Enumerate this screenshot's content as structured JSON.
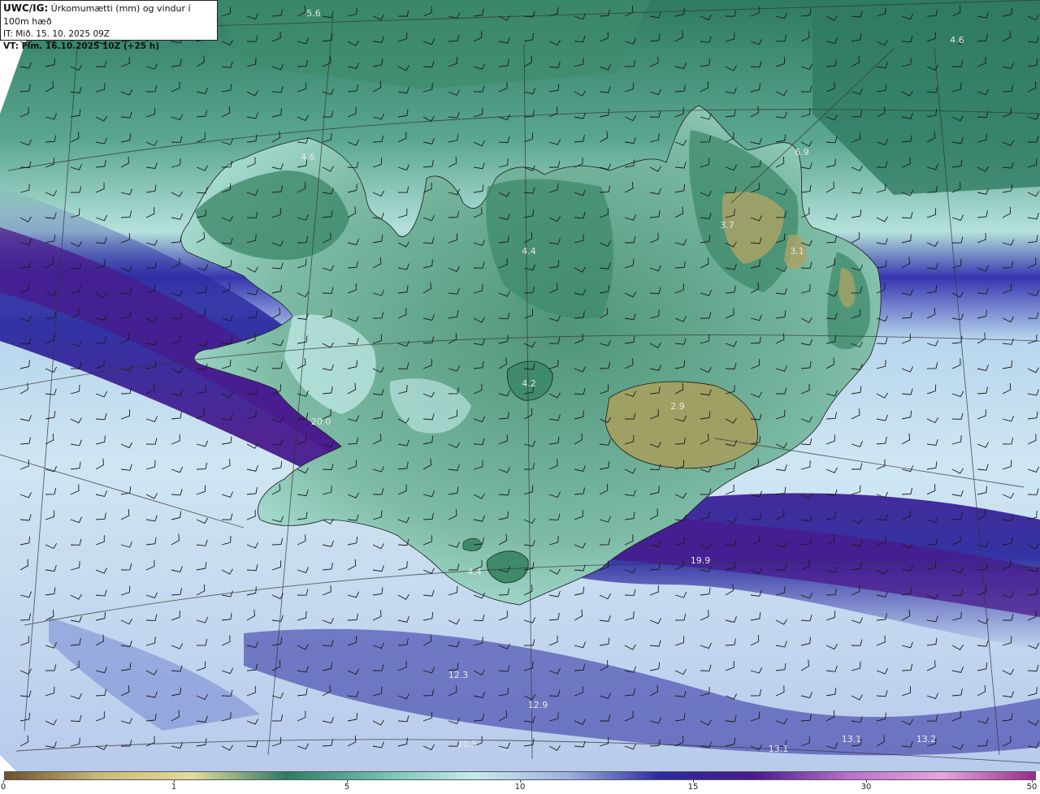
{
  "header": {
    "product_code": "UWC/IG:",
    "product_desc": "Úrkomumætti (mm) og vindur í 100m hæð",
    "issue_time": "IT: Mið. 15. 10. 2025 09Z",
    "valid_time": "VT: Fim. 16.10.2025 10Z (+25 h)"
  },
  "map_labels": [
    {
      "id": "nw-sea",
      "text": "5.6"
    },
    {
      "id": "ne-sea",
      "text": "4.6"
    },
    {
      "id": "westfjords",
      "text": "4.6"
    },
    {
      "id": "northeast",
      "text": "6.9"
    },
    {
      "id": "ne-high",
      "text": "3.7"
    },
    {
      "id": "east-high",
      "text": "3.1"
    },
    {
      "id": "north-center",
      "text": "4.4"
    },
    {
      "id": "langjokull",
      "text": "4.2"
    },
    {
      "id": "vatnajokull",
      "text": "2.9"
    },
    {
      "id": "reykjanes",
      "text": "20.0"
    },
    {
      "id": "south-sea",
      "text": "19.9"
    },
    {
      "id": "myrdalsjokull",
      "text": "4.4"
    },
    {
      "id": "sw-1",
      "text": "12.3"
    },
    {
      "id": "sw-2",
      "text": "10.5"
    },
    {
      "id": "s-1",
      "text": "12.9"
    },
    {
      "id": "se-1",
      "text": "13.1"
    },
    {
      "id": "se-2",
      "text": "13.1"
    },
    {
      "id": "se-3",
      "text": "13.2"
    }
  ],
  "colorbar": {
    "ticks": [
      "0",
      "1",
      "5",
      "10",
      "15",
      "30",
      "50"
    ],
    "colors": [
      "#6e4f2a",
      "#c9b978",
      "#e3dc9a",
      "#2f7a62",
      "#6fbfae",
      "#c6ecec",
      "#9fb2e0",
      "#2b2ba0",
      "#4a1a8c",
      "#b86fc8",
      "#e7a6dd",
      "#9a2a8a"
    ]
  }
}
